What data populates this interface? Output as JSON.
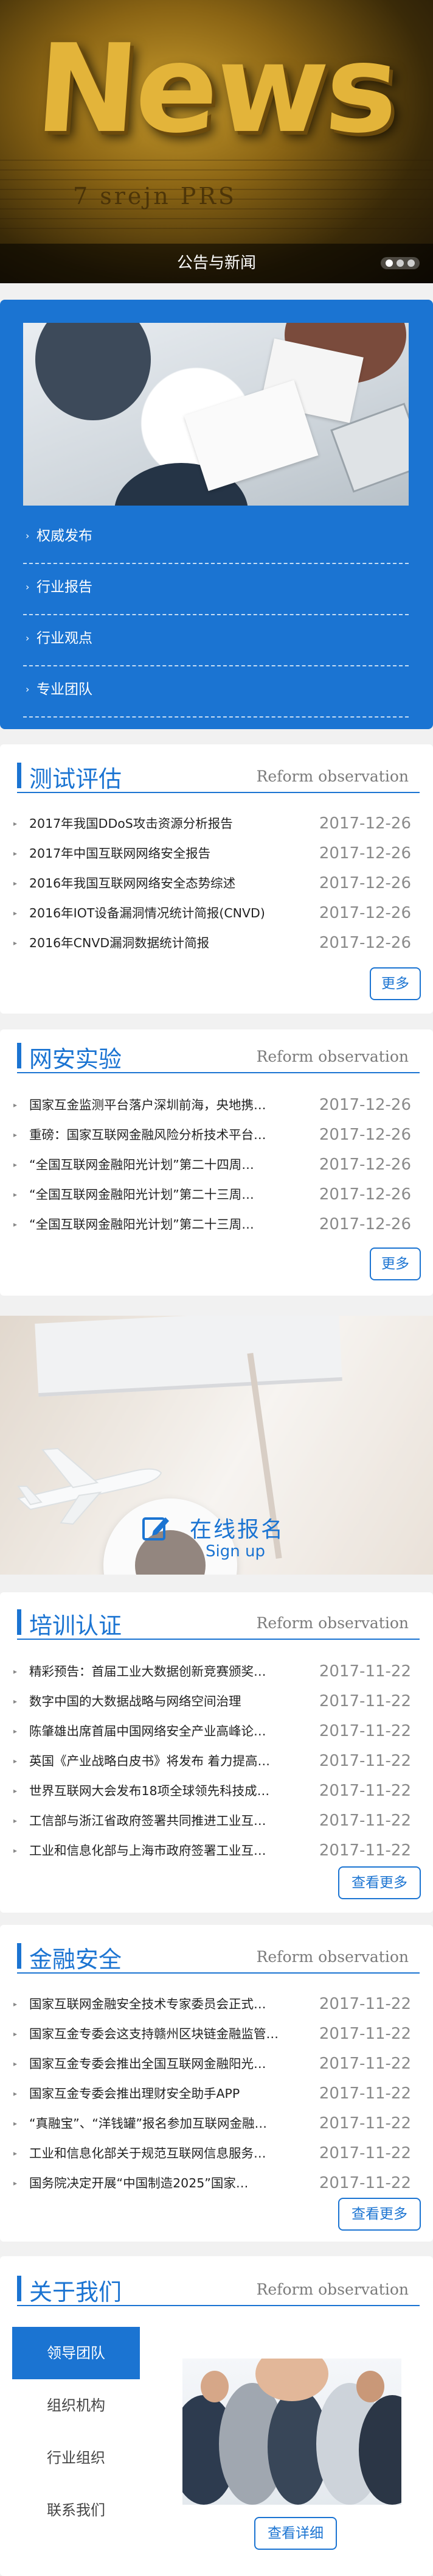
{
  "hero": {
    "word": "News",
    "newsprint": "7 srejn PRS",
    "caption": "公告与新闻",
    "slide_count": 3,
    "active_slide": 0
  },
  "categories": {
    "items": [
      {
        "label": "权威发布"
      },
      {
        "label": "行业报告"
      },
      {
        "label": "行业观点"
      },
      {
        "label": "专业团队"
      }
    ]
  },
  "sections": {
    "test": {
      "title": "测试评估",
      "subtitle": "Reform observation",
      "items": [
        {
          "title": "2017年我国DDoS攻击资源分析报告",
          "date": "2017-12-26"
        },
        {
          "title": "2017年中国互联网网络安全报告",
          "date": "2017-12-26"
        },
        {
          "title": "2016年我国互联网网络安全态势综述",
          "date": "2017-12-26"
        },
        {
          "title": "2016年IOT设备漏洞情况统计简报(CNVD)",
          "date": "2017-12-26"
        },
        {
          "title": "2016年CNVD漏洞数据统计简报",
          "date": "2017-12-26"
        }
      ],
      "more": "更多"
    },
    "lab": {
      "title": "网安实验",
      "subtitle": "Reform observation",
      "items": [
        {
          "title": "国家互金监测平台落户深圳前海，央地携…",
          "date": "2017-12-26"
        },
        {
          "title": "重磅：国家互联网金融风险分析技术平台…",
          "date": "2017-12-26"
        },
        {
          "title": "“全国互联网金融阳光计划”第二十四周…",
          "date": "2017-12-26"
        },
        {
          "title": "“全国互联网金融阳光计划”第二十三周…",
          "date": "2017-12-26"
        },
        {
          "title": "“全国互联网金融阳光计划”第二十三周…",
          "date": "2017-12-26"
        }
      ],
      "more": "更多"
    },
    "training": {
      "title": "培训认证",
      "subtitle": "Reform observation",
      "items": [
        {
          "title": "精彩预告：首届工业大数据创新竞赛颁奖…",
          "date": "2017-11-22"
        },
        {
          "title": "数字中国的大数据战略与网络空间治理",
          "date": "2017-11-22"
        },
        {
          "title": "陈肇雄出席首届中国网络安全产业高峰论…",
          "date": "2017-11-22"
        },
        {
          "title": "英国《产业战略白皮书》将发布 着力提高…",
          "date": "2017-11-22"
        },
        {
          "title": "世界互联网大会发布18项全球领先科技成…",
          "date": "2017-11-22"
        },
        {
          "title": "工信部与浙江省政府签署共同推进工业互…",
          "date": "2017-11-22"
        },
        {
          "title": "工业和信息化部与上海市政府签署工业互…",
          "date": "2017-11-22"
        }
      ],
      "more": "查看更多"
    },
    "finance": {
      "title": "金融安全",
      "subtitle": "Reform observation",
      "items": [
        {
          "title": "国家互联网金融安全技术专家委员会正式…",
          "date": "2017-11-22"
        },
        {
          "title": "国家互金专委会这支持赣州区块链金融监管…",
          "date": "2017-11-22"
        },
        {
          "title": "国家互金专委会推出全国互联网金融阳光…",
          "date": "2017-11-22"
        },
        {
          "title": "国家互金专委会推出理财安全助手APP",
          "date": "2017-11-22"
        },
        {
          "title": "“真融宝”、“洋钱罐”报名参加互联网金融…",
          "date": "2017-11-22"
        },
        {
          "title": "工业和信息化部关于规范互联网信息服务…",
          "date": "2017-11-22"
        },
        {
          "title": "国务院决定开展“中国制造2025”国家…",
          "date": "2017-11-22"
        }
      ],
      "more": "查看更多"
    }
  },
  "signup": {
    "title": "在线报名",
    "subtitle": "Sign up"
  },
  "about": {
    "title": "关于我们",
    "subtitle": "Reform observation",
    "tabs": [
      {
        "label": "领导团队"
      },
      {
        "label": "组织机构"
      },
      {
        "label": "行业组织"
      },
      {
        "label": "联系我们"
      }
    ],
    "active_tab": 0,
    "detail_button": "查看详细"
  },
  "colors": {
    "primary": "#1b74d2",
    "background": "#f1f1f1",
    "date_text": "#8a8a8a"
  }
}
